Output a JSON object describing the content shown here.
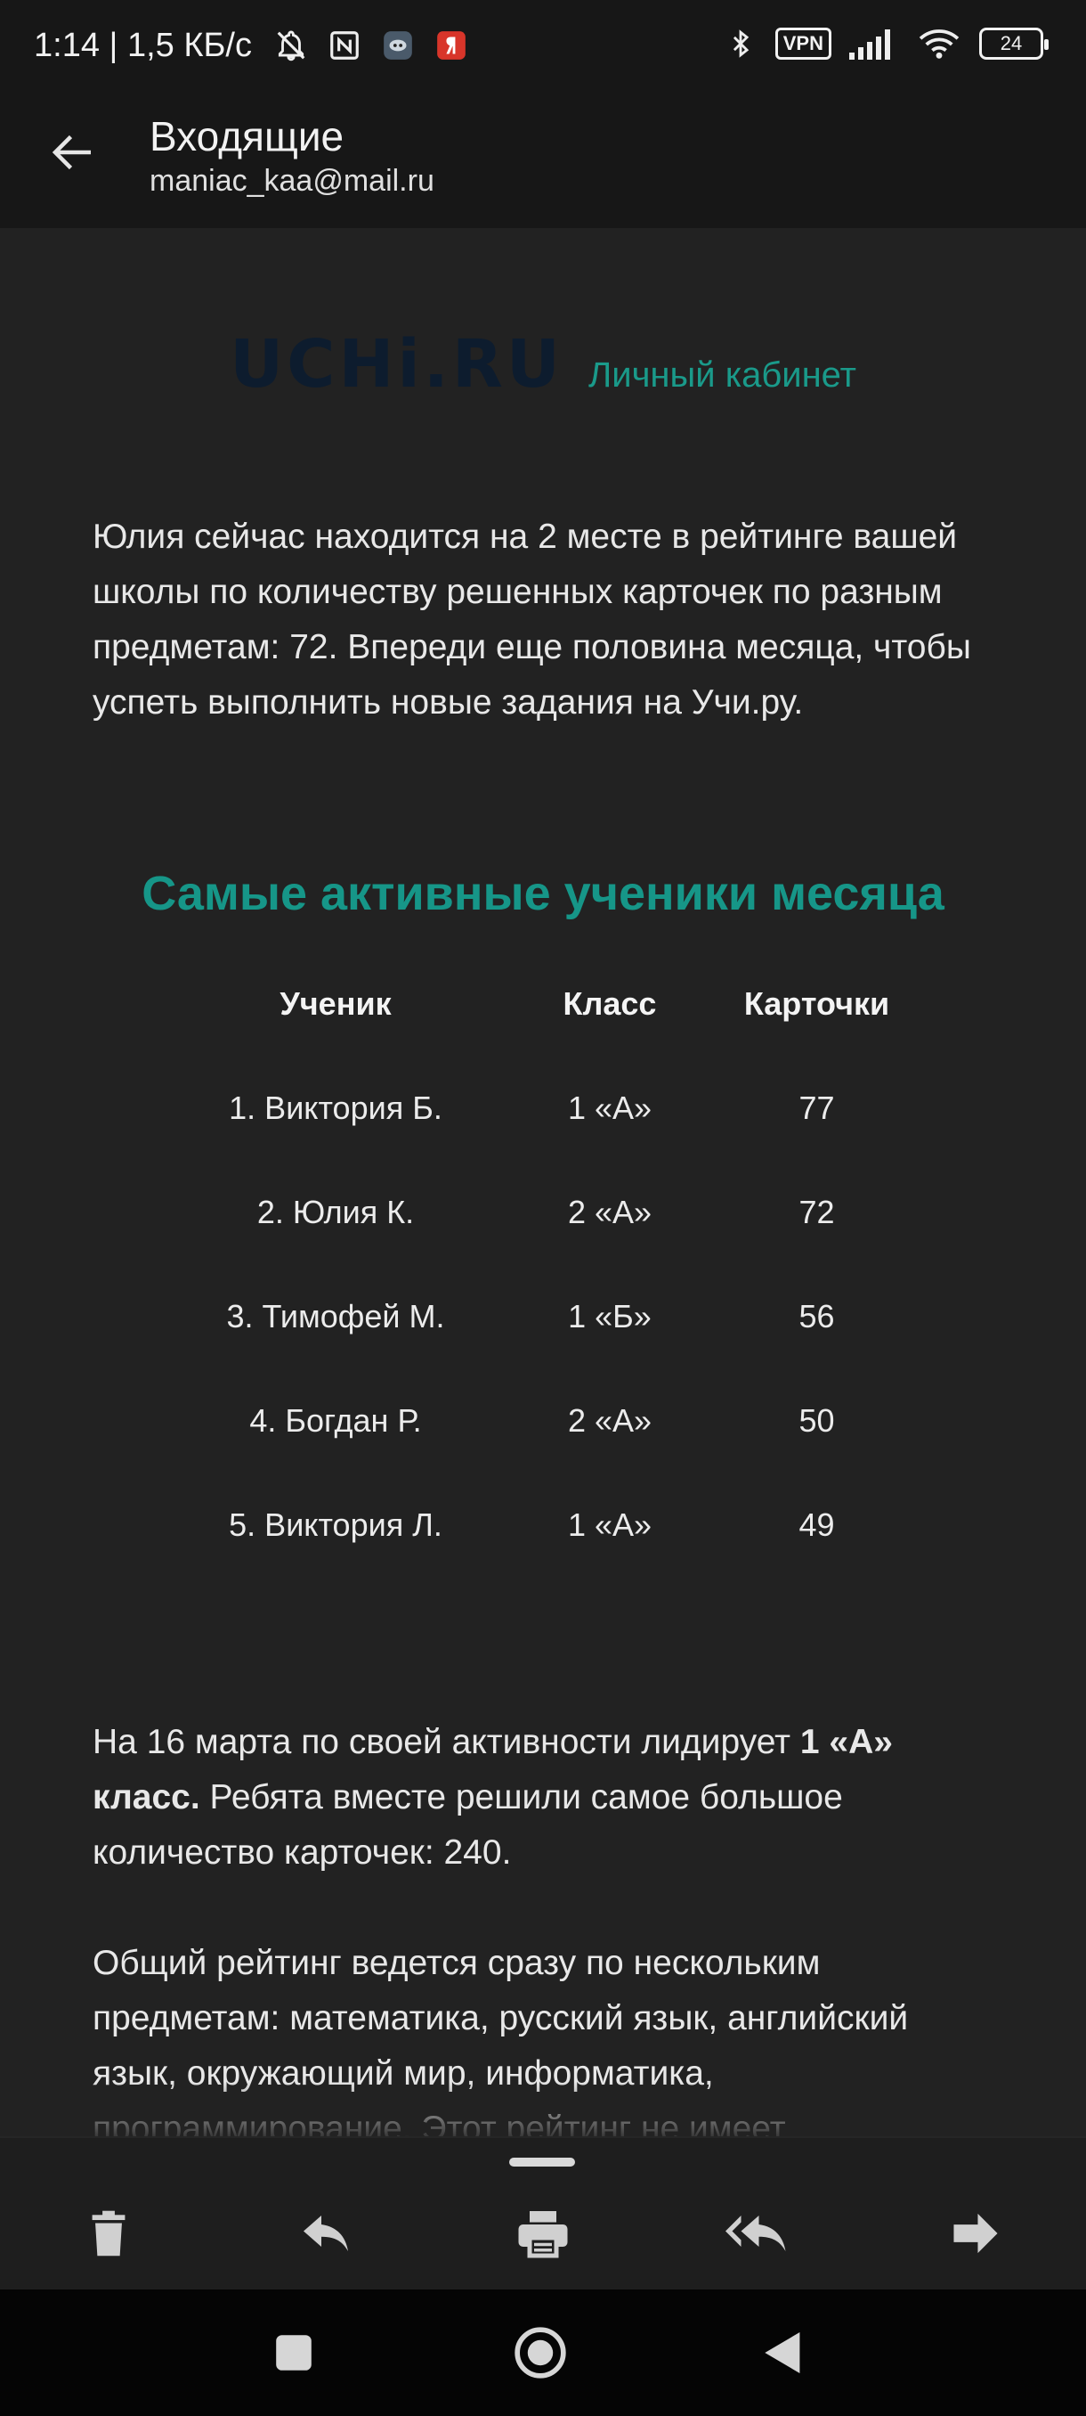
{
  "status_bar": {
    "time_speed": "1:14 | 1,5 КБ/с",
    "vpn": "VPN",
    "battery": "24",
    "icons": [
      "bell-off-icon",
      "nfc-icon",
      "bot-app-icon",
      "yandex-icon",
      "bluetooth-icon",
      "signal-icon",
      "wifi-icon",
      "battery-icon"
    ]
  },
  "header": {
    "title": "Входящие",
    "account": "maniac_kaa@mail.ru",
    "back_icon": "arrow-back-icon"
  },
  "email": {
    "logo_text": "UCHi.RU",
    "logo_link": "Личный кабинет",
    "intro": "Юлия сейчас находится на 2 месте в рейтинге вашей школы по количеству решенных карточек по разным предметам: 72. Впереди еще половина месяца, чтобы успеть выполнить новые задания на Учи.ру.",
    "leaders_title": "Самые активные ученики месяца",
    "columns": [
      "Ученик",
      "Класс",
      "Карточки"
    ],
    "rows": [
      [
        "1. Виктория Б.",
        "1 «А»",
        "77"
      ],
      [
        "2. Юлия К.",
        "2 «А»",
        "72"
      ],
      [
        "3. Тимофей М.",
        "1 «Б»",
        "56"
      ],
      [
        "4. Богдан Р.",
        "2 «А»",
        "50"
      ],
      [
        "5. Виктория Л.",
        "1 «А»",
        "49"
      ]
    ],
    "class_para": {
      "before": "На 16 марта по своей активности лидирует ",
      "bold": "1 «А» класс.",
      "after": " Ребята вместе решили самое большое количество карточек: 240."
    },
    "rating_para": "Общий рейтинг ведется сразу по нескольким предметам: математика, русский язык, английский язык, окружающий мир, информатика, программирование. Этот рейтинг не имеет"
  },
  "actions": [
    "trash-icon",
    "reply-icon",
    "print-icon",
    "reply-all-icon",
    "forward-icon"
  ],
  "navigation": [
    "recents-square-icon",
    "home-circle-icon",
    "back-triangle-icon"
  ],
  "colors": {
    "background": "#222222",
    "bar": "#171717",
    "accent": "#169688",
    "logo": "#0d1c2e"
  }
}
